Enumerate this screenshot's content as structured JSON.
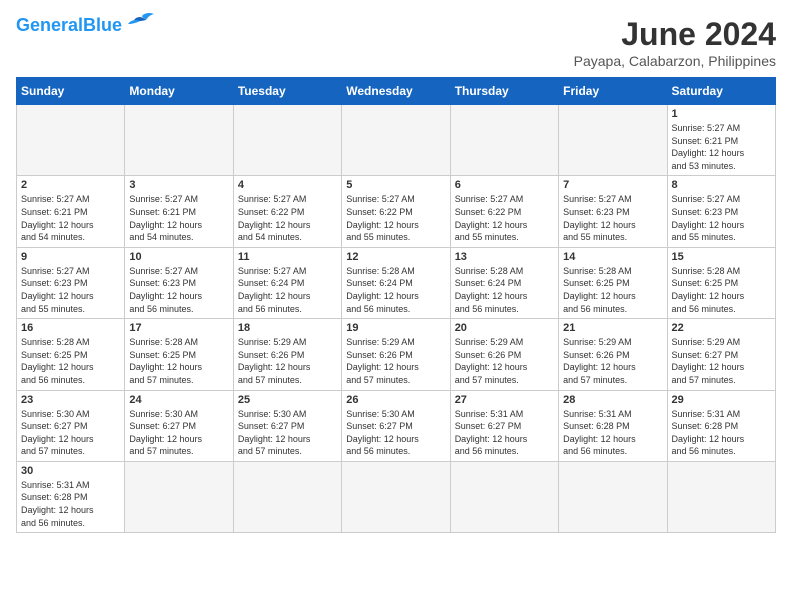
{
  "header": {
    "logo_general": "General",
    "logo_blue": "Blue",
    "title": "June 2024",
    "subtitle": "Payapa, Calabarzon, Philippines"
  },
  "weekdays": [
    "Sunday",
    "Monday",
    "Tuesday",
    "Wednesday",
    "Thursday",
    "Friday",
    "Saturday"
  ],
  "days": [
    {
      "date": "1",
      "sunrise": "5:27 AM",
      "sunset": "6:21 PM",
      "daylight": "12 hours and 53 minutes."
    },
    {
      "date": "2",
      "sunrise": "5:27 AM",
      "sunset": "6:21 PM",
      "daylight": "12 hours and 54 minutes."
    },
    {
      "date": "3",
      "sunrise": "5:27 AM",
      "sunset": "6:21 PM",
      "daylight": "12 hours and 54 minutes."
    },
    {
      "date": "4",
      "sunrise": "5:27 AM",
      "sunset": "6:22 PM",
      "daylight": "12 hours and 54 minutes."
    },
    {
      "date": "5",
      "sunrise": "5:27 AM",
      "sunset": "6:22 PM",
      "daylight": "12 hours and 55 minutes."
    },
    {
      "date": "6",
      "sunrise": "5:27 AM",
      "sunset": "6:22 PM",
      "daylight": "12 hours and 55 minutes."
    },
    {
      "date": "7",
      "sunrise": "5:27 AM",
      "sunset": "6:23 PM",
      "daylight": "12 hours and 55 minutes."
    },
    {
      "date": "8",
      "sunrise": "5:27 AM",
      "sunset": "6:23 PM",
      "daylight": "12 hours and 55 minutes."
    },
    {
      "date": "9",
      "sunrise": "5:27 AM",
      "sunset": "6:23 PM",
      "daylight": "12 hours and 55 minutes."
    },
    {
      "date": "10",
      "sunrise": "5:27 AM",
      "sunset": "6:23 PM",
      "daylight": "12 hours and 56 minutes."
    },
    {
      "date": "11",
      "sunrise": "5:27 AM",
      "sunset": "6:24 PM",
      "daylight": "12 hours and 56 minutes."
    },
    {
      "date": "12",
      "sunrise": "5:28 AM",
      "sunset": "6:24 PM",
      "daylight": "12 hours and 56 minutes."
    },
    {
      "date": "13",
      "sunrise": "5:28 AM",
      "sunset": "6:24 PM",
      "daylight": "12 hours and 56 minutes."
    },
    {
      "date": "14",
      "sunrise": "5:28 AM",
      "sunset": "6:25 PM",
      "daylight": "12 hours and 56 minutes."
    },
    {
      "date": "15",
      "sunrise": "5:28 AM",
      "sunset": "6:25 PM",
      "daylight": "12 hours and 56 minutes."
    },
    {
      "date": "16",
      "sunrise": "5:28 AM",
      "sunset": "6:25 PM",
      "daylight": "12 hours and 56 minutes."
    },
    {
      "date": "17",
      "sunrise": "5:28 AM",
      "sunset": "6:25 PM",
      "daylight": "12 hours and 57 minutes."
    },
    {
      "date": "18",
      "sunrise": "5:29 AM",
      "sunset": "6:26 PM",
      "daylight": "12 hours and 57 minutes."
    },
    {
      "date": "19",
      "sunrise": "5:29 AM",
      "sunset": "6:26 PM",
      "daylight": "12 hours and 57 minutes."
    },
    {
      "date": "20",
      "sunrise": "5:29 AM",
      "sunset": "6:26 PM",
      "daylight": "12 hours and 57 minutes."
    },
    {
      "date": "21",
      "sunrise": "5:29 AM",
      "sunset": "6:26 PM",
      "daylight": "12 hours and 57 minutes."
    },
    {
      "date": "22",
      "sunrise": "5:29 AM",
      "sunset": "6:27 PM",
      "daylight": "12 hours and 57 minutes."
    },
    {
      "date": "23",
      "sunrise": "5:30 AM",
      "sunset": "6:27 PM",
      "daylight": "12 hours and 57 minutes."
    },
    {
      "date": "24",
      "sunrise": "5:30 AM",
      "sunset": "6:27 PM",
      "daylight": "12 hours and 57 minutes."
    },
    {
      "date": "25",
      "sunrise": "5:30 AM",
      "sunset": "6:27 PM",
      "daylight": "12 hours and 57 minutes."
    },
    {
      "date": "26",
      "sunrise": "5:30 AM",
      "sunset": "6:27 PM",
      "daylight": "12 hours and 56 minutes."
    },
    {
      "date": "27",
      "sunrise": "5:31 AM",
      "sunset": "6:27 PM",
      "daylight": "12 hours and 56 minutes."
    },
    {
      "date": "28",
      "sunrise": "5:31 AM",
      "sunset": "6:28 PM",
      "daylight": "12 hours and 56 minutes."
    },
    {
      "date": "29",
      "sunrise": "5:31 AM",
      "sunset": "6:28 PM",
      "daylight": "12 hours and 56 minutes."
    },
    {
      "date": "30",
      "sunrise": "5:31 AM",
      "sunset": "6:28 PM",
      "daylight": "12 hours and 56 minutes."
    }
  ],
  "labels": {
    "sunrise": "Sunrise:",
    "sunset": "Sunset:",
    "daylight": "Daylight:"
  }
}
